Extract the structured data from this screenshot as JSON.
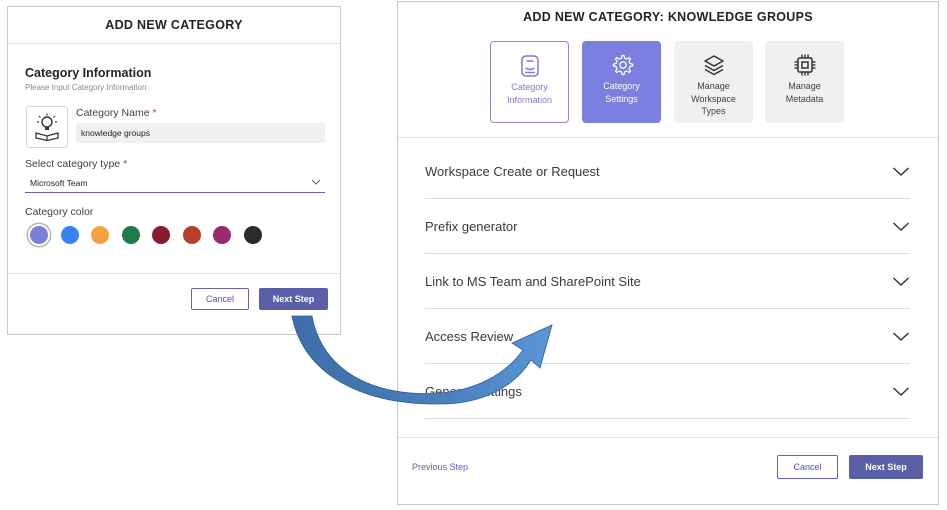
{
  "left_dialog": {
    "title": "ADD NEW CATEGORY",
    "section_title": "Category Information",
    "section_subtitle": "Please Input Category Information",
    "icon": "lightbulb-book-icon",
    "category_name_label": "Category Name",
    "required_mark": "*",
    "category_name_value": "knowledge groups",
    "category_type_label": "Select category type",
    "category_type_value": "Microsoft Team",
    "category_color_label": "Category color",
    "colors": [
      "#7b7fd8",
      "#3b82f6",
      "#f5a142",
      "#1f7a4a",
      "#8b1a2b",
      "#b5412a",
      "#9a2a6b",
      "#2b2b2b"
    ],
    "selected_color_index": 0,
    "cancel_label": "Cancel",
    "next_label": "Next Step"
  },
  "right_dialog": {
    "title": "ADD NEW CATEGORY: KNOWLEDGE GROUPS",
    "steps": [
      {
        "line1": "Category",
        "line2": "Information",
        "line3": "",
        "icon": "badge-icon",
        "state": "done"
      },
      {
        "line1": "Category",
        "line2": "Settings",
        "line3": "",
        "icon": "gear-icon",
        "state": "active"
      },
      {
        "line1": "Manage",
        "line2": "Workspace",
        "line3": "Types",
        "icon": "layers-icon",
        "state": "pending"
      },
      {
        "line1": "Manage",
        "line2": "Metadata",
        "line3": "",
        "icon": "chip-icon",
        "state": "pending"
      }
    ],
    "sections": [
      "Workspace Create or Request",
      "Prefix generator",
      "Link to MS Team and SharePoint Site",
      "Access Review",
      "General Settings"
    ],
    "previous_label": "Previous Step",
    "cancel_label": "Cancel",
    "next_label": "Next Step"
  },
  "colors": {
    "accent": "#6264a7",
    "active_step": "#7b7fe0",
    "arrow": "#3f6fa8",
    "required": "#c4314b"
  }
}
